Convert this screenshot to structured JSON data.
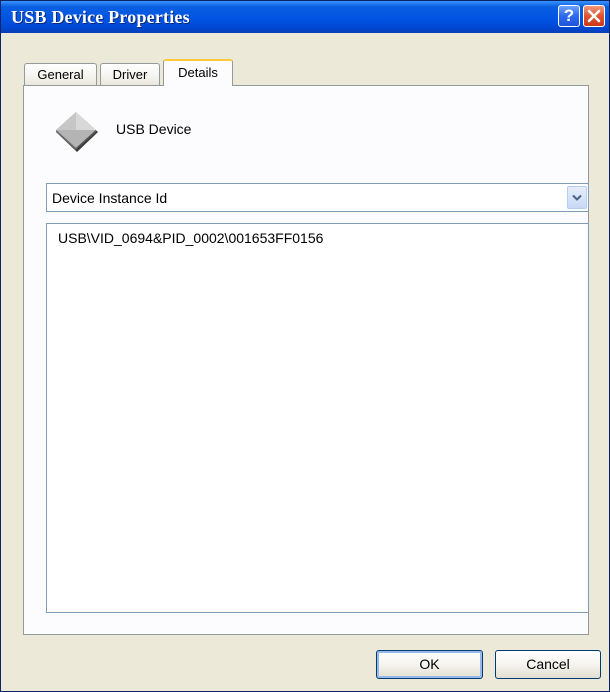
{
  "window": {
    "title": "USB Device Properties",
    "help_icon": "help-question-icon",
    "close_icon": "close-x-icon"
  },
  "tabs": [
    {
      "label": "General",
      "active": false
    },
    {
      "label": "Driver",
      "active": false
    },
    {
      "label": "Details",
      "active": true
    }
  ],
  "device": {
    "name": "USB Device",
    "icon": "generic-device-diamond-icon"
  },
  "property_dropdown": {
    "selected": "Device Instance Id"
  },
  "values_list": {
    "items": [
      "USB\\VID_0694&PID_0002\\001653FF0156"
    ]
  },
  "buttons": {
    "ok": "OK",
    "cancel": "Cancel"
  },
  "colors": {
    "titlebar": "#0054e3",
    "active_tab_highlight": "#ffc83c",
    "dialog_background": "#ece9d8",
    "close_button": "#e0532f"
  }
}
